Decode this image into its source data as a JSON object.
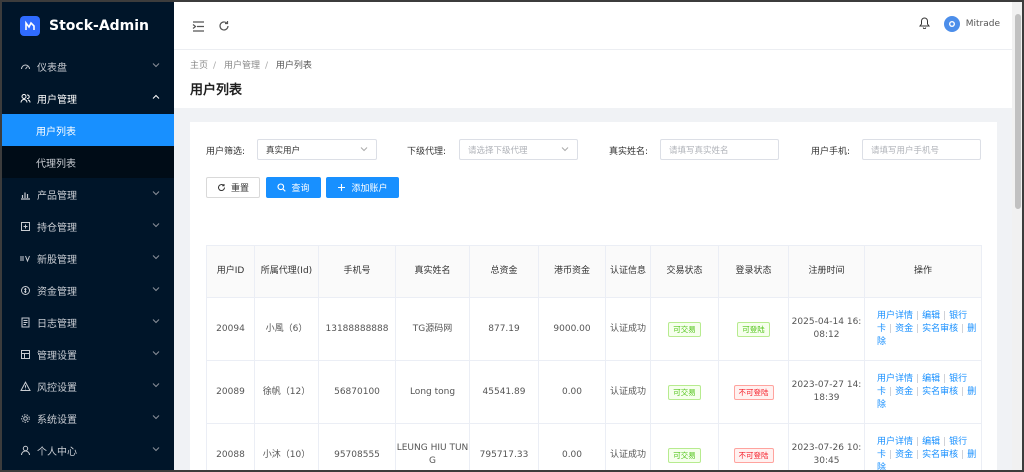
{
  "app": {
    "title": "Stock-Admin"
  },
  "sidebar": {
    "items": [
      {
        "label": "仪表盘",
        "icon": "dashboard-icon",
        "open": false
      },
      {
        "label": "用户管理",
        "icon": "users-icon",
        "open": true,
        "children": [
          {
            "label": "用户列表",
            "active": true
          },
          {
            "label": "代理列表",
            "active": false
          }
        ]
      },
      {
        "label": "产品管理",
        "icon": "chart-icon",
        "open": false
      },
      {
        "label": "持仓管理",
        "icon": "position-icon",
        "open": false
      },
      {
        "label": "新股管理",
        "icon": "ipo-icon",
        "open": false
      },
      {
        "label": "资金管理",
        "icon": "money-icon",
        "open": false
      },
      {
        "label": "日志管理",
        "icon": "log-icon",
        "open": false
      },
      {
        "label": "管理设置",
        "icon": "admin-settings-icon",
        "open": false
      },
      {
        "label": "风控设置",
        "icon": "risk-warning-icon",
        "open": false
      },
      {
        "label": "系统设置",
        "icon": "gear-icon",
        "open": false
      },
      {
        "label": "个人中心",
        "icon": "person-icon",
        "open": false
      }
    ]
  },
  "header": {
    "username": "Mitrade"
  },
  "breadcrumb": [
    "主页",
    "用户管理",
    "用户列表"
  ],
  "page": {
    "title": "用户列表"
  },
  "filters": {
    "user_filter_label": "用户筛选:",
    "user_filter_value": "真实用户",
    "agent_label": "下级代理:",
    "agent_placeholder": "请选择下级代理",
    "realname_label": "真实姓名:",
    "realname_placeholder": "请填写真实姓名",
    "phone_label": "用户手机:",
    "phone_placeholder": "请填写用户手机号"
  },
  "buttons": {
    "reset": "重置",
    "search": "查询",
    "add": "添加账户"
  },
  "table": {
    "headers": [
      "用户ID",
      "所属代理(Id)",
      "手机号",
      "真实姓名",
      "总资金",
      "港币资金",
      "认证信息",
      "交易状态",
      "登录状态",
      "注册时间",
      "操作"
    ],
    "rows": [
      {
        "id": "20094",
        "agent": "小風（6）",
        "phone": "13188888888",
        "name": "TG源码网",
        "total": "877.19",
        "hkd": "9000.00",
        "auth": "认证成功",
        "trade": "可交易",
        "trade_ok": true,
        "login": "可登陆",
        "login_ok": true,
        "reg": "2025-04-14 16:08:12"
      },
      {
        "id": "20089",
        "agent": "徐帆（12）",
        "phone": "56870100",
        "name": "Long tong",
        "total": "45541.89",
        "hkd": "0.00",
        "auth": "认证成功",
        "trade": "可交易",
        "trade_ok": true,
        "login": "不可登陆",
        "login_ok": false,
        "reg": "2023-07-27 14:18:39"
      },
      {
        "id": "20088",
        "agent": "小沐（10）",
        "phone": "95708555",
        "name": "LEUNG HIU TUNG",
        "total": "795717.33",
        "hkd": "0.00",
        "auth": "认证成功",
        "trade": "可交易",
        "trade_ok": true,
        "login": "不可登陆",
        "login_ok": false,
        "reg": "2023-07-26 10:30:45"
      }
    ],
    "ops": [
      "用户详情",
      "编辑",
      "银行卡",
      "资金",
      "实名审核",
      "删除"
    ]
  },
  "colors": {
    "primary": "#1890ff",
    "sidebar_bg": "#001529",
    "success": "#52c41a",
    "danger": "#f5222d"
  }
}
